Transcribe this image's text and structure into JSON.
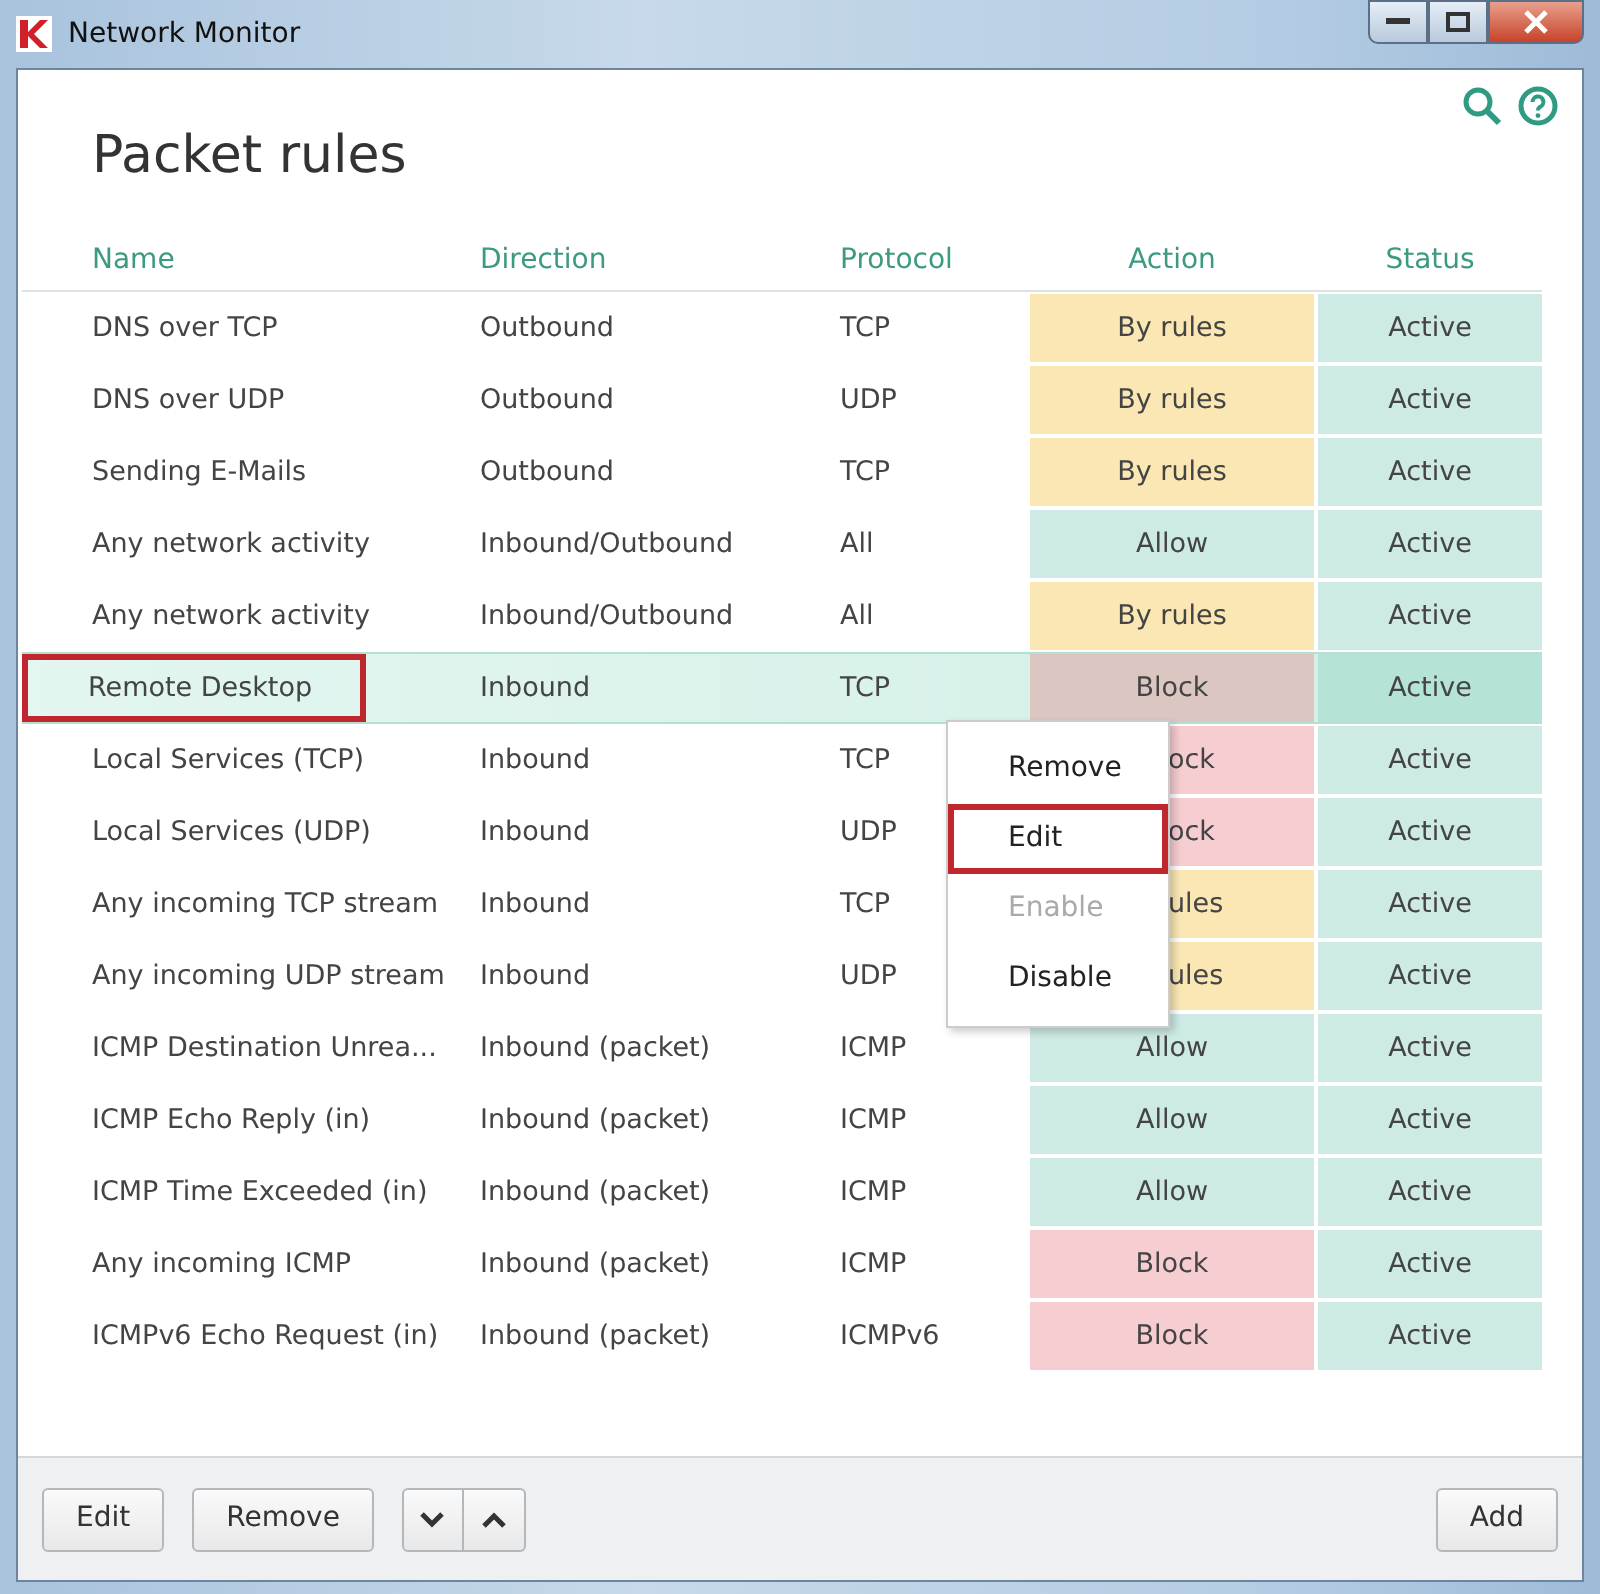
{
  "window": {
    "title": "Network Monitor"
  },
  "page_title": "Packet rules",
  "columns": [
    "Name",
    "Direction",
    "Protocol",
    "Action",
    "Status"
  ],
  "rows": [
    {
      "name": "DNS over TCP",
      "direction": "Outbound",
      "protocol": "TCP",
      "action": {
        "text": "By rules",
        "color": "#fbe7b3",
        "covered": false
      },
      "status": "Active",
      "selected": false,
      "outlined": false
    },
    {
      "name": "DNS over UDP",
      "direction": "Outbound",
      "protocol": "UDP",
      "action": {
        "text": "By rules",
        "color": "#fbe7b3",
        "covered": false
      },
      "status": "Active",
      "selected": false,
      "outlined": false
    },
    {
      "name": "Sending E-Mails",
      "direction": "Outbound",
      "protocol": "TCP",
      "action": {
        "text": "By rules",
        "color": "#fbe7b3",
        "covered": false
      },
      "status": "Active",
      "selected": false,
      "outlined": false
    },
    {
      "name": "Any network activity",
      "direction": "Inbound/Outbound",
      "protocol": "All",
      "action": {
        "text": "Allow",
        "color": "#cdeae5",
        "covered": false
      },
      "status": "Active",
      "selected": false,
      "outlined": false
    },
    {
      "name": "Any network activity",
      "direction": "Inbound/Outbound",
      "protocol": "All",
      "action": {
        "text": "By rules",
        "color": "#fbe7b3",
        "covered": false
      },
      "status": "Active",
      "selected": false,
      "outlined": false
    },
    {
      "name": "Remote Desktop",
      "direction": "Inbound",
      "protocol": "TCP",
      "action": {
        "text": "Block",
        "color": "#dcc6c2",
        "covered": false
      },
      "status": "Active",
      "selected": true,
      "outlined": true
    },
    {
      "name": "Local Services (TCP)",
      "direction": "Inbound",
      "protocol": "TCP",
      "action": {
        "text": "ock",
        "color": "#f6cdd1",
        "covered": true
      },
      "status": "Active",
      "selected": false,
      "outlined": false
    },
    {
      "name": "Local Services (UDP)",
      "direction": "Inbound",
      "protocol": "UDP",
      "action": {
        "text": "ock",
        "color": "#f6cdd1",
        "covered": true
      },
      "status": "Active",
      "selected": false,
      "outlined": false
    },
    {
      "name": "Any incoming TCP stream",
      "direction": "Inbound",
      "protocol": "TCP",
      "action": {
        "text": "ules",
        "color": "#fbe7b3",
        "covered": true
      },
      "status": "Active",
      "selected": false,
      "outlined": false
    },
    {
      "name": "Any incoming UDP stream",
      "direction": "Inbound",
      "protocol": "UDP",
      "action": {
        "text": "ules",
        "color": "#fbe7b3",
        "covered": true
      },
      "status": "Active",
      "selected": false,
      "outlined": false
    },
    {
      "name": "ICMP Destination Unrea...",
      "direction": "Inbound (packet)",
      "protocol": "ICMP",
      "action": {
        "text": "Allow",
        "color": "#cdeae5",
        "covered": false
      },
      "status": "Active",
      "selected": false,
      "outlined": false
    },
    {
      "name": "ICMP Echo Reply (in)",
      "direction": "Inbound (packet)",
      "protocol": "ICMP",
      "action": {
        "text": "Allow",
        "color": "#cdeae5",
        "covered": false
      },
      "status": "Active",
      "selected": false,
      "outlined": false
    },
    {
      "name": "ICMP Time Exceeded (in)",
      "direction": "Inbound (packet)",
      "protocol": "ICMP",
      "action": {
        "text": "Allow",
        "color": "#cdeae5",
        "covered": false
      },
      "status": "Active",
      "selected": false,
      "outlined": false
    },
    {
      "name": "Any incoming ICMP",
      "direction": "Inbound (packet)",
      "protocol": "ICMP",
      "action": {
        "text": "Block",
        "color": "#f6cdd1",
        "covered": false
      },
      "status": "Active",
      "selected": false,
      "outlined": false
    },
    {
      "name": "ICMPv6 Echo Request (in)",
      "direction": "Inbound (packet)",
      "protocol": "ICMPv6",
      "action": {
        "text": "Block",
        "color": "#f6cdd1",
        "covered": false
      },
      "status": "Active",
      "selected": false,
      "outlined": false
    }
  ],
  "context_menu": [
    {
      "label": "Remove",
      "disabled": false,
      "outlined": false
    },
    {
      "label": "Edit",
      "disabled": false,
      "outlined": true
    },
    {
      "label": "Enable",
      "disabled": true,
      "outlined": false
    },
    {
      "label": "Disable",
      "disabled": false,
      "outlined": false
    }
  ],
  "footer_buttons": [
    {
      "label": "Edit"
    },
    {
      "label": "Remove"
    }
  ],
  "add_button": "Add"
}
